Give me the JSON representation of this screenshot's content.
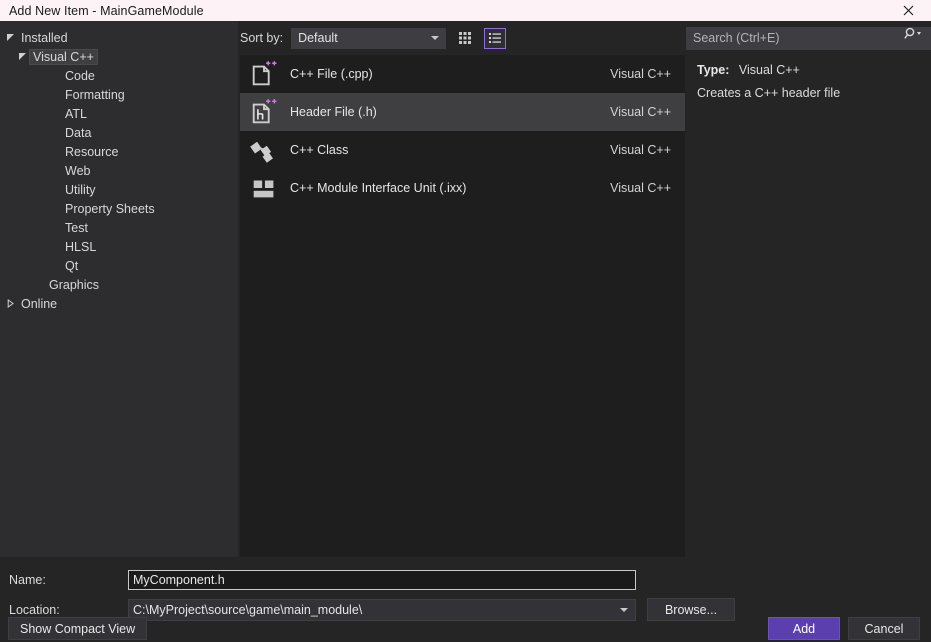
{
  "window": {
    "title": "Add New Item - MainGameModule",
    "close_icon": "close-icon"
  },
  "sidebar": {
    "nodes": [
      {
        "label": "Installed",
        "depth": 0,
        "state": "expanded",
        "selected": false
      },
      {
        "label": "Visual C++",
        "depth": 1,
        "state": "expanded",
        "selected": true
      },
      {
        "label": "Code",
        "depth": 2,
        "state": "leaf",
        "selected": false
      },
      {
        "label": "Formatting",
        "depth": 2,
        "state": "leaf",
        "selected": false
      },
      {
        "label": "ATL",
        "depth": 2,
        "state": "leaf",
        "selected": false
      },
      {
        "label": "Data",
        "depth": 2,
        "state": "leaf",
        "selected": false
      },
      {
        "label": "Resource",
        "depth": 2,
        "state": "leaf",
        "selected": false
      },
      {
        "label": "Web",
        "depth": 2,
        "state": "leaf",
        "selected": false
      },
      {
        "label": "Utility",
        "depth": 2,
        "state": "leaf",
        "selected": false
      },
      {
        "label": "Property Sheets",
        "depth": 2,
        "state": "leaf",
        "selected": false
      },
      {
        "label": "Test",
        "depth": 2,
        "state": "leaf",
        "selected": false
      },
      {
        "label": "HLSL",
        "depth": 2,
        "state": "leaf",
        "selected": false
      },
      {
        "label": "Qt",
        "depth": 2,
        "state": "leaf",
        "selected": false
      },
      {
        "label": "Graphics",
        "depth": 1,
        "state": "leaf",
        "selected": false
      },
      {
        "label": "Online",
        "depth": 0,
        "state": "collapsed",
        "selected": false
      }
    ]
  },
  "toolbar": {
    "sort_label": "Sort by:",
    "sort_value": "Default",
    "grid_view_icon": "grid-view-icon",
    "list_view_icon": "list-view-icon",
    "active_view": "list"
  },
  "templates": {
    "items": [
      {
        "name": "C++ File (.cpp)",
        "origin": "Visual C++",
        "icon": "cpp-file-icon",
        "selected": false
      },
      {
        "name": "Header File (.h)",
        "origin": "Visual C++",
        "icon": "header-file-icon",
        "selected": true
      },
      {
        "name": "C++ Class",
        "origin": "Visual C++",
        "icon": "cpp-class-icon",
        "selected": false
      },
      {
        "name": "C++ Module Interface Unit (.ixx)",
        "origin": "Visual C++",
        "icon": "cpp-module-icon",
        "selected": false
      }
    ]
  },
  "search": {
    "placeholder": "Search (Ctrl+E)",
    "value": "",
    "icon": "search-icon"
  },
  "details": {
    "type_label": "Type:",
    "type_value": "Visual C++",
    "description": "Creates a C++ header file"
  },
  "form": {
    "name_label": "Name:",
    "name_value": "MyComponent.h",
    "location_label": "Location:",
    "location_value": "C:\\MyProject\\source\\game\\main_module\\",
    "browse_label": "Browse..."
  },
  "buttons": {
    "compact_label": "Show Compact View",
    "add_label": "Add",
    "cancel_label": "Cancel"
  },
  "colors": {
    "accent": "#5b3fae",
    "title_bar": "#fdf3f6",
    "panel": "#252526",
    "list_bg": "#1e1e1e",
    "selection": "#3f3f41",
    "icon_accent": "#c07fd8"
  }
}
